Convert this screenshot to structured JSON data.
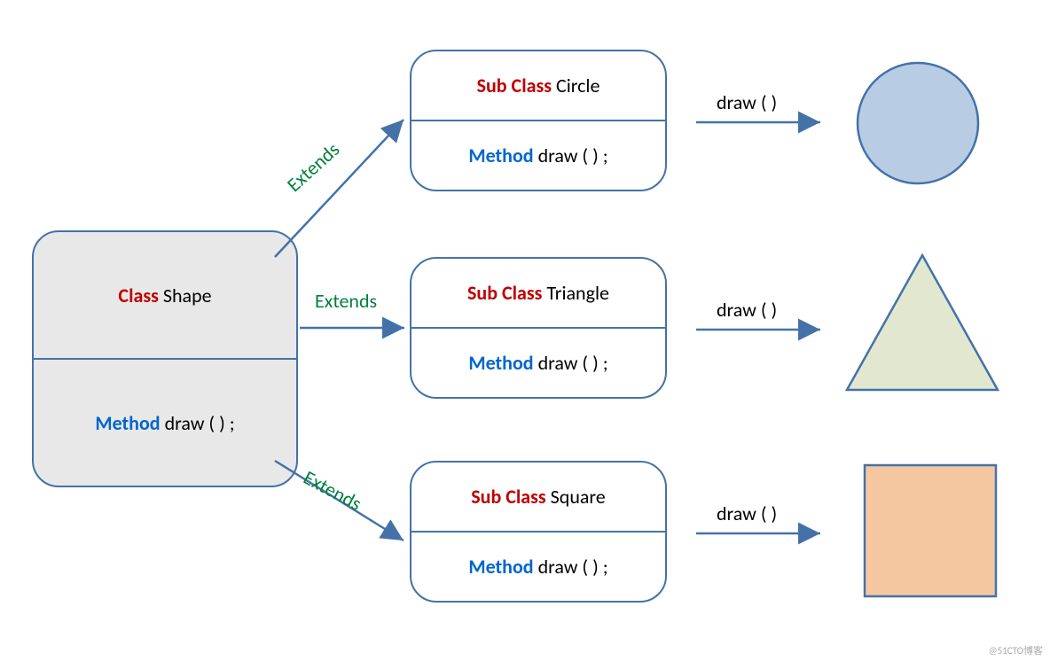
{
  "parent": {
    "keyword": "Class",
    "name": " Shape",
    "methodKeyword": "Method",
    "methodSig": " draw ( ) ;"
  },
  "subs": [
    {
      "keyword": "Sub Class",
      "name": " Circle",
      "methodKeyword": "Method",
      "methodSig": " draw ( ) ;"
    },
    {
      "keyword": "Sub Class",
      "name": " Triangle",
      "methodKeyword": "Method",
      "methodSig": " draw ( ) ;"
    },
    {
      "keyword": "Sub Class",
      "name": " Square",
      "methodKeyword": "Method",
      "methodSig": " draw ( ) ;"
    }
  ],
  "labels": {
    "extends": "Extends",
    "draw": "draw ( )"
  },
  "colors": {
    "border": "#4472A8",
    "red": "#C00000",
    "blue": "#0066CC",
    "green": "#00803D",
    "circleFill": "#B8CCE4",
    "triangleFill": "#E2E8D0",
    "squareFill": "#F4C7A0"
  },
  "watermark": "@51CTO博客"
}
